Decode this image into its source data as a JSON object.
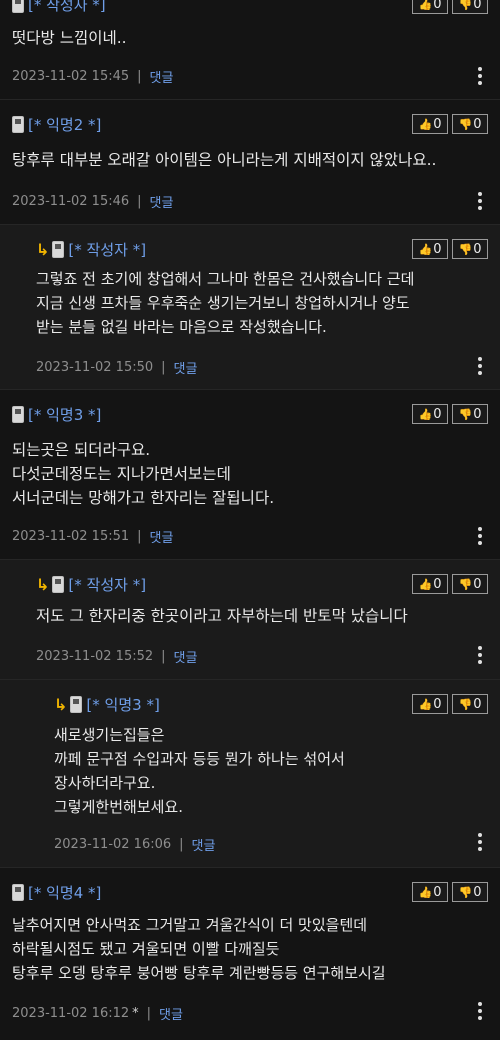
{
  "comments": [
    {
      "author": "[* 작성자 *]",
      "text": "떳다방 느낌이네..",
      "time": "2023-11-02 15:45",
      "reply": "댓글",
      "up": "0",
      "down": "0"
    },
    {
      "author": "[* 익명2 *]",
      "text": "탕후루 대부분 오래갈 아이템은 아니라는게 지배적이지 않았나요..",
      "time": "2023-11-02 15:46",
      "reply": "댓글",
      "up": "0",
      "down": "0"
    },
    {
      "author": "[* 작성자 *]",
      "text": "그렇죠 전 초기에 창업해서 그나마 한몸은 건사했습니다 근데\n지금 신생 프차들 우후죽순 생기는거보니 창업하시거나 양도\n받는 분들 없길 바라는 마음으로 작성했습니다.",
      "time": "2023-11-02 15:50",
      "reply": "댓글",
      "up": "0",
      "down": "0"
    },
    {
      "author": "[* 익명3 *]",
      "text": "되는곳은 되더라구요.\n다섯군데정도는 지나가면서보는데\n서너군데는 망해가고 한자리는 잘됩니다.",
      "time": "2023-11-02 15:51",
      "reply": "댓글",
      "up": "0",
      "down": "0"
    },
    {
      "author": "[* 작성자 *]",
      "text": "저도 그 한자리중 한곳이라고 자부하는데 반토막 났습니다",
      "time": "2023-11-02 15:52",
      "reply": "댓글",
      "up": "0",
      "down": "0"
    },
    {
      "author": "[* 익명3 *]",
      "text": "새로생기는집들은\n까페 문구점 수입과자 등등 뭔가 하나는 섞어서\n장사하더라구요.\n그렇게한번해보세요.",
      "time": "2023-11-02 16:06",
      "reply": "댓글",
      "up": "0",
      "down": "0"
    },
    {
      "author": "[* 익명4 *]",
      "text": "날추어지면 안사먹죠 그거말고 겨울간식이 더 맛있을텐데\n하락될시점도 됐고 겨울되면 이빨 다깨질듯\n탕후루 오뎅 탕후루 붕어빵 탕후루 계란빵등등 연구해보시길",
      "time": "2023-11-02 16:12",
      "star": "*",
      "reply": "댓글",
      "up": "0",
      "down": "0"
    }
  ],
  "icons": {
    "up": "thumbs-up-icon",
    "down": "thumbs-down-icon",
    "more": "more-vertical-icon",
    "reply_arrow": "reply-arrow-icon",
    "mobile": "mobile-phone-icon"
  },
  "colors": {
    "author": "#6f9ee8",
    "background": "#111111",
    "reply_arrow": "#f0b400"
  }
}
